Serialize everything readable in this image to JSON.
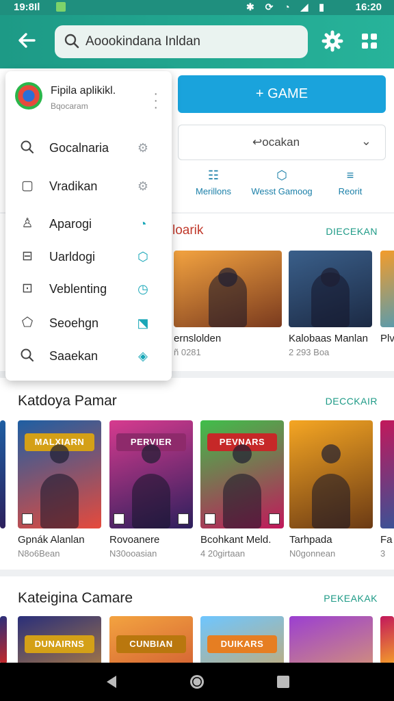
{
  "status": {
    "time_left": "19:8Il",
    "time_right": "16:20",
    "icons": "✱ ⟳ ◔ ◢ ▮"
  },
  "appbar": {
    "search_text": "Aoookindana Inldan"
  },
  "top": {
    "game_button": "+ GAME",
    "select_value": "↩ocakan",
    "tabs": [
      {
        "label": "Merillons",
        "icon": "☷"
      },
      {
        "label": "Wesst Gamoog",
        "icon": "⬡"
      },
      {
        "label": "Reorit",
        "icon": "≡"
      }
    ]
  },
  "section1": {
    "title_fragment": "loarik",
    "link": "DIECEKAN",
    "items": [
      {
        "title": "ernslolden",
        "sub": "ñ 0281",
        "colors": [
          "#f3a340",
          "#7a3a1e"
        ]
      },
      {
        "title": "Kalobaas Manlan",
        "sub": "2 293 Boa",
        "colors": [
          "#3a5f8a",
          "#1c2a44"
        ]
      },
      {
        "title": "Plv",
        "sub": "",
        "colors": [
          "#f39c2b",
          "#2f9bd1"
        ]
      }
    ]
  },
  "section2": {
    "title": "Katdoya Pamar",
    "link": "DECCKAIR",
    "items": [
      {
        "title": "Gpnák Alanlan",
        "sub": "N8o6Bean",
        "banner": "MALXIARN",
        "colors": [
          "#1e5fa3",
          "#e64a3c"
        ]
      },
      {
        "title": "Rovoanere",
        "sub": "N30ooasian",
        "banner": "PERVIER",
        "colors": [
          "#d73b8f",
          "#2c1f5c"
        ]
      },
      {
        "title": "Bcohkant Meld.",
        "sub": "4 20girtaan",
        "banner": "PEVNARS",
        "colors": [
          "#3fbf4a",
          "#c2185b"
        ]
      },
      {
        "title": "Tarhpada",
        "sub": "N0gonnean",
        "banner": "",
        "colors": [
          "#f5a623",
          "#6b3a14"
        ]
      },
      {
        "title": "Fa",
        "sub": "3",
        "banner": "",
        "colors": [
          "#c2185b",
          "#1e5fa3"
        ]
      }
    ]
  },
  "section3": {
    "title": "Kateigina Camare",
    "link": "PEKEAKAK",
    "items": [
      {
        "banner": "DUNAIRNS",
        "colors": [
          "#2a2f7a",
          "#f5a623"
        ]
      },
      {
        "banner": "CUNBIAN",
        "colors": [
          "#f3a340",
          "#c0392b"
        ]
      },
      {
        "banner": "DUIKARS",
        "colors": [
          "#6ec6ff",
          "#f39c2b"
        ]
      },
      {
        "banner": "",
        "colors": [
          "#9b3fd1",
          "#f5c542"
        ]
      }
    ]
  },
  "menu": {
    "title": "Fipila aplikikl.",
    "subtitle": "Bqocaram",
    "items": [
      {
        "label": "Gocalnaria",
        "icon": "search-icon",
        "glyph": "⚲",
        "right": "⚙",
        "right_color": "#9aa0a6"
      },
      {
        "label": "Vradikan",
        "icon": "square-icon",
        "glyph": "▢",
        "right": "⚙",
        "right_color": "#9aa0a6"
      },
      {
        "label": "Aparogi",
        "icon": "user-icon",
        "glyph": "♙",
        "right": "◔",
        "right_color": "#19a7b8"
      },
      {
        "label": "Uarldogi",
        "icon": "folder-icon",
        "glyph": "⊟",
        "right": "⬡",
        "right_color": "#19a7b8"
      },
      {
        "label": "Veblenting",
        "icon": "frame-icon",
        "glyph": "⊡",
        "right": "◷",
        "right_color": "#19a7b8"
      },
      {
        "label": "Seoehgn",
        "icon": "shield-icon",
        "glyph": "⬠",
        "right": "⬔",
        "right_color": "#19a7b8"
      },
      {
        "label": "Saaekan",
        "icon": "search-icon",
        "glyph": "⚲",
        "right": "◈",
        "right_color": "#19a7b8"
      }
    ]
  }
}
